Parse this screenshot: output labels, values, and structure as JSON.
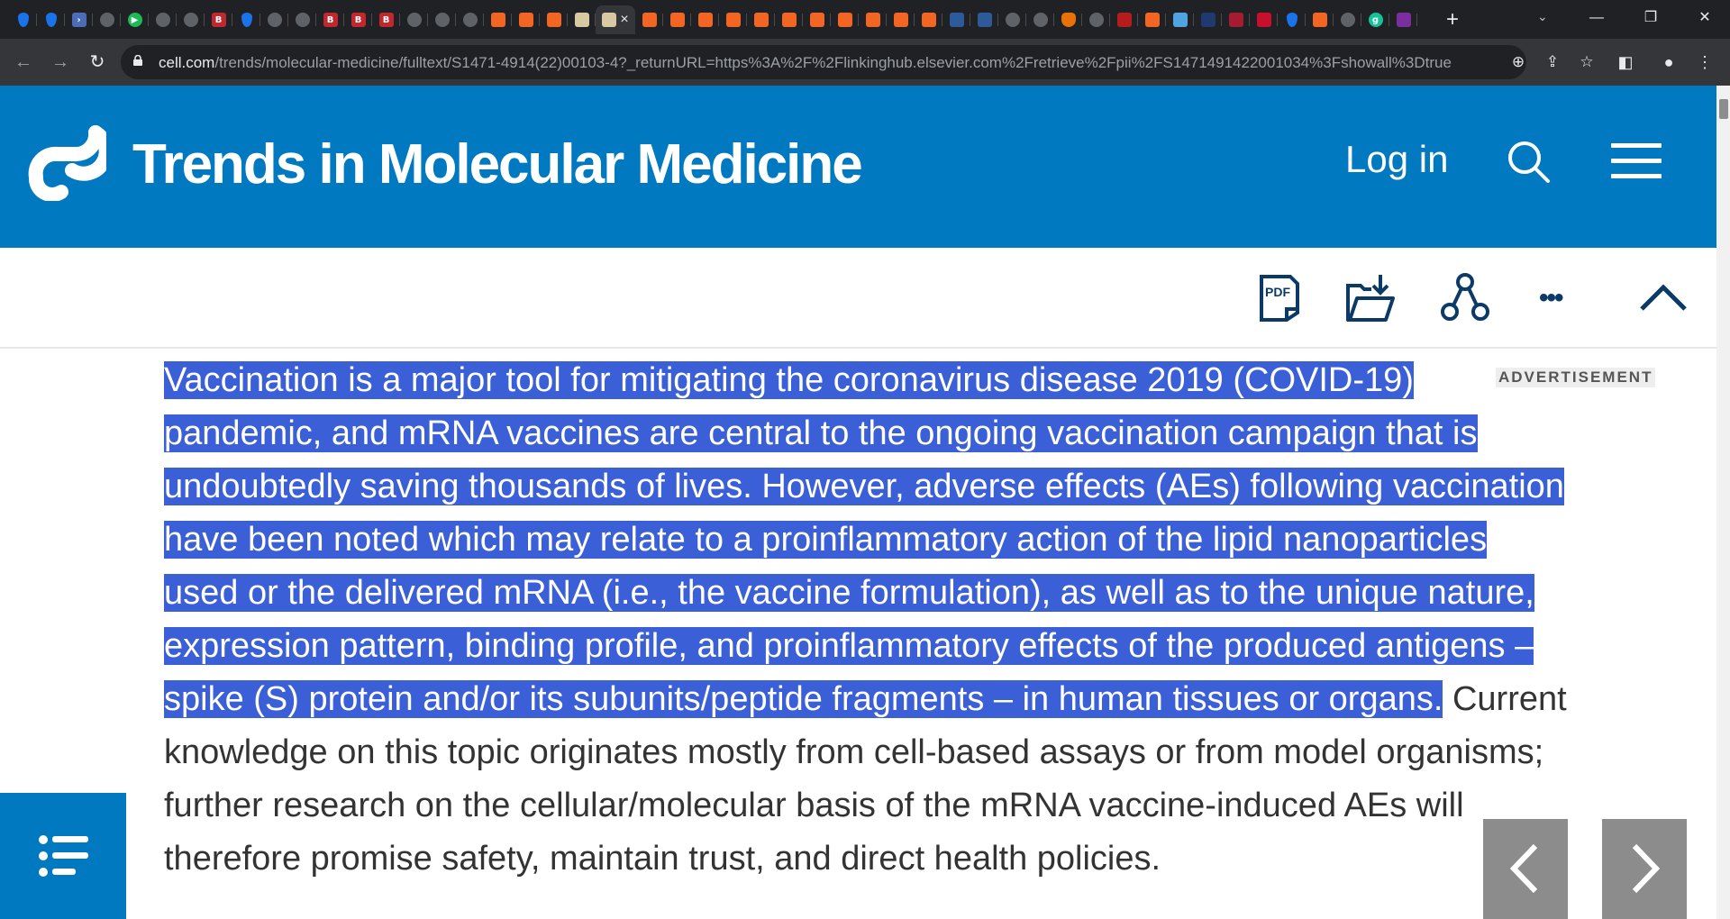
{
  "browser": {
    "active_tab_close": "×",
    "new_tab": "+",
    "tab_search": "⌄",
    "window_controls": {
      "minimize": "—",
      "restore": "❐",
      "close": "✕"
    },
    "url": {
      "domain": "cell.com",
      "path": "/trends/molecular-medicine/fulltext/S1471-4914(22)00103-4?_returnURL=https%3A%2F%2Flinkinghub.elsevier.com%2Fretrieve%2Fpii%2FS1471491422001034%3Fshowall%3Dtrue"
    },
    "nav": {
      "back": "←",
      "forward": "→",
      "reload": "↻"
    }
  },
  "header": {
    "journal_title": "Trends in Molecular Medicine",
    "login_label": "Log in",
    "brand_color": "#0079c0"
  },
  "article": {
    "selected_text": "Vaccination is a major tool for mitigating the coronavirus disease 2019 (COVID-19) pandemic, and mRNA vaccines are central to the ongoing vaccination campaign that is undoubtedly saving thousands of lives. However, adverse effects (AEs) following vaccination have been noted which may relate to a proinflammatory action of the lipid nanoparticles used or the delivered mRNA (i.e., the vaccine formulation), as well as to the unique nature, expression pattern, binding profile, and proinflammatory effects of the produced antigens – spike (S) protein and/or its subunits/peptide fragments – in human tissues or organs.",
    "rest_text": " Current knowledge on this topic originates mostly from cell-based assays or from model organisms; further research on the cellular/molecular basis of the mRNA vaccine-induced AEs will therefore promise safety, maintain trust, and direct health policies.",
    "selection_color": "#3a5fd6"
  },
  "advertisement_label": "ADVERTISEMENT",
  "tools": {
    "pdf_label": "PDF",
    "more": "•••"
  }
}
